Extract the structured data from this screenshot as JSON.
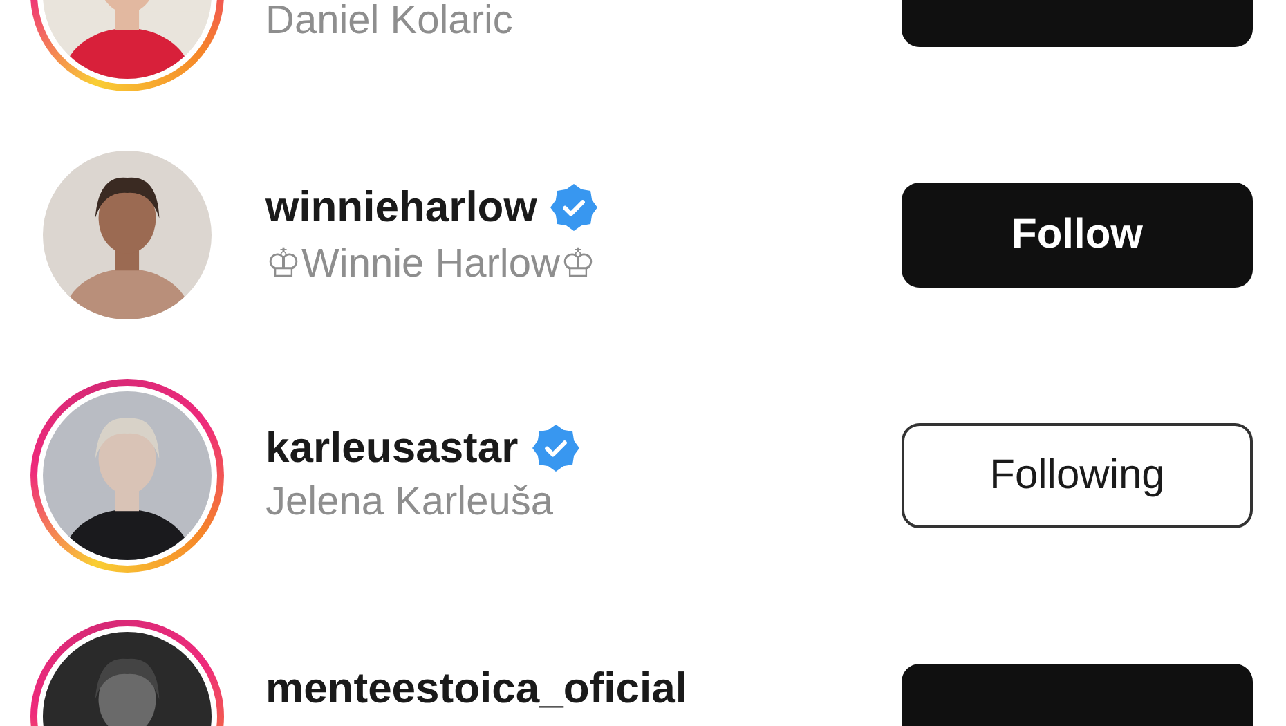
{
  "accounts": [
    {
      "subtitle": "Daniel Kolaric",
      "story_ring": true,
      "following": false
    },
    {
      "username": "winnieharlow",
      "verified": true,
      "subtitle": "♔Winnie Harlow♔",
      "story_ring": false,
      "following": false,
      "button": "Follow"
    },
    {
      "username": "karleusastar",
      "verified": true,
      "subtitle": "Jelena Karleuša",
      "story_ring": true,
      "following": true,
      "button": "Following"
    },
    {
      "username": "menteestoica_oficial",
      "verified": false,
      "story_ring": true,
      "following": false
    }
  ]
}
